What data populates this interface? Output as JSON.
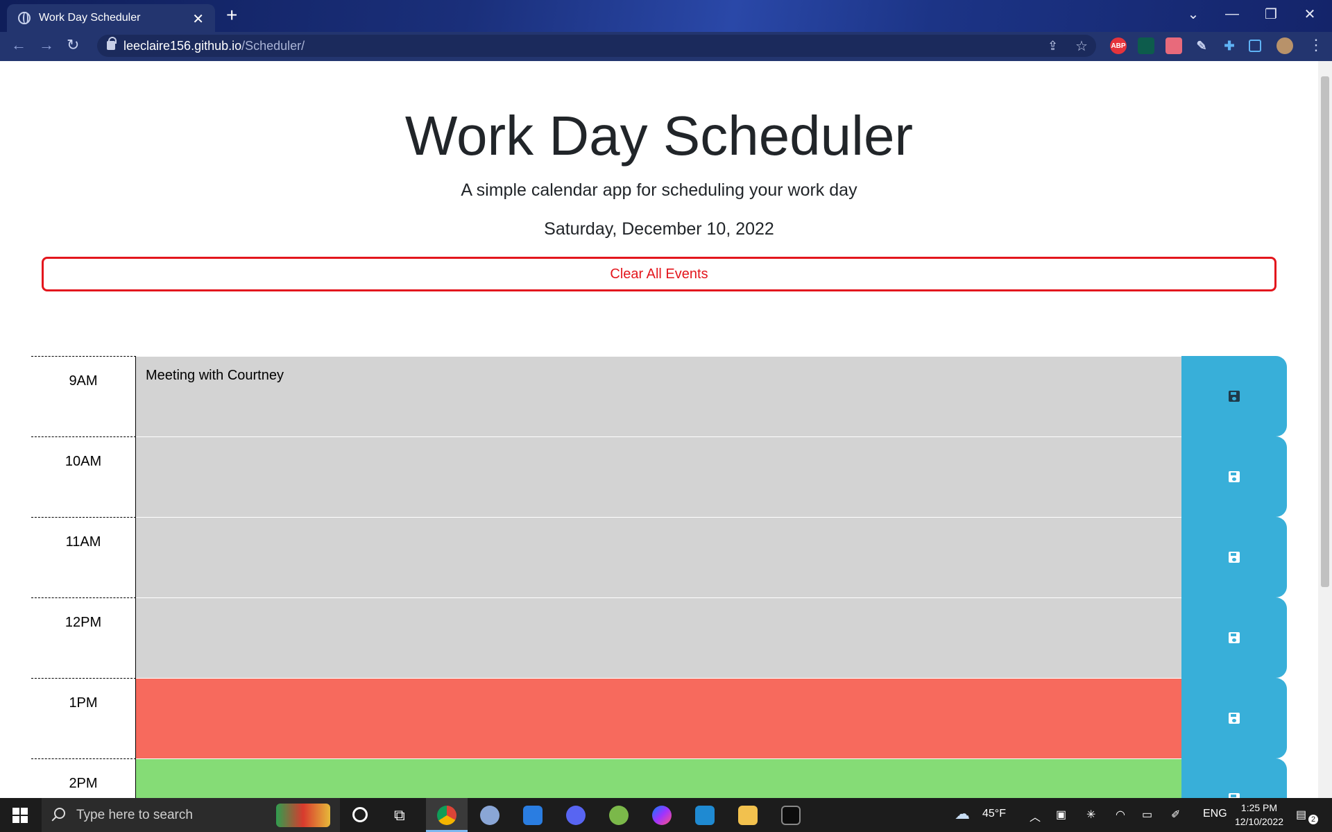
{
  "browser": {
    "tab_title": "Work Day Scheduler",
    "url_host": "leeclaire156.github.io",
    "url_path": "/Scheduler/"
  },
  "page": {
    "title": "Work Day Scheduler",
    "subtitle": "A simple calendar app for scheduling your work day",
    "current_date": "Saturday, December 10, 2022",
    "clear_button_label": "Clear All Events"
  },
  "schedule": {
    "rows": [
      {
        "hour": "9AM",
        "event": "Meeting with Courtney",
        "state": "past"
      },
      {
        "hour": "10AM",
        "event": "",
        "state": "past"
      },
      {
        "hour": "11AM",
        "event": "",
        "state": "past"
      },
      {
        "hour": "12PM",
        "event": "",
        "state": "past"
      },
      {
        "hour": "1PM",
        "event": "",
        "state": "present"
      },
      {
        "hour": "2PM",
        "event": "",
        "state": "future"
      }
    ],
    "colors": {
      "past": "#d3d3d3",
      "present": "#f76a5d",
      "future": "#85dc76",
      "save": "#38afd9",
      "clear": "#e3161d"
    }
  },
  "taskbar": {
    "search_placeholder": "Type here to search",
    "weather": "45°F",
    "language": "ENG",
    "time": "1:25 PM",
    "date": "12/10/2022",
    "notification_count": "2"
  }
}
